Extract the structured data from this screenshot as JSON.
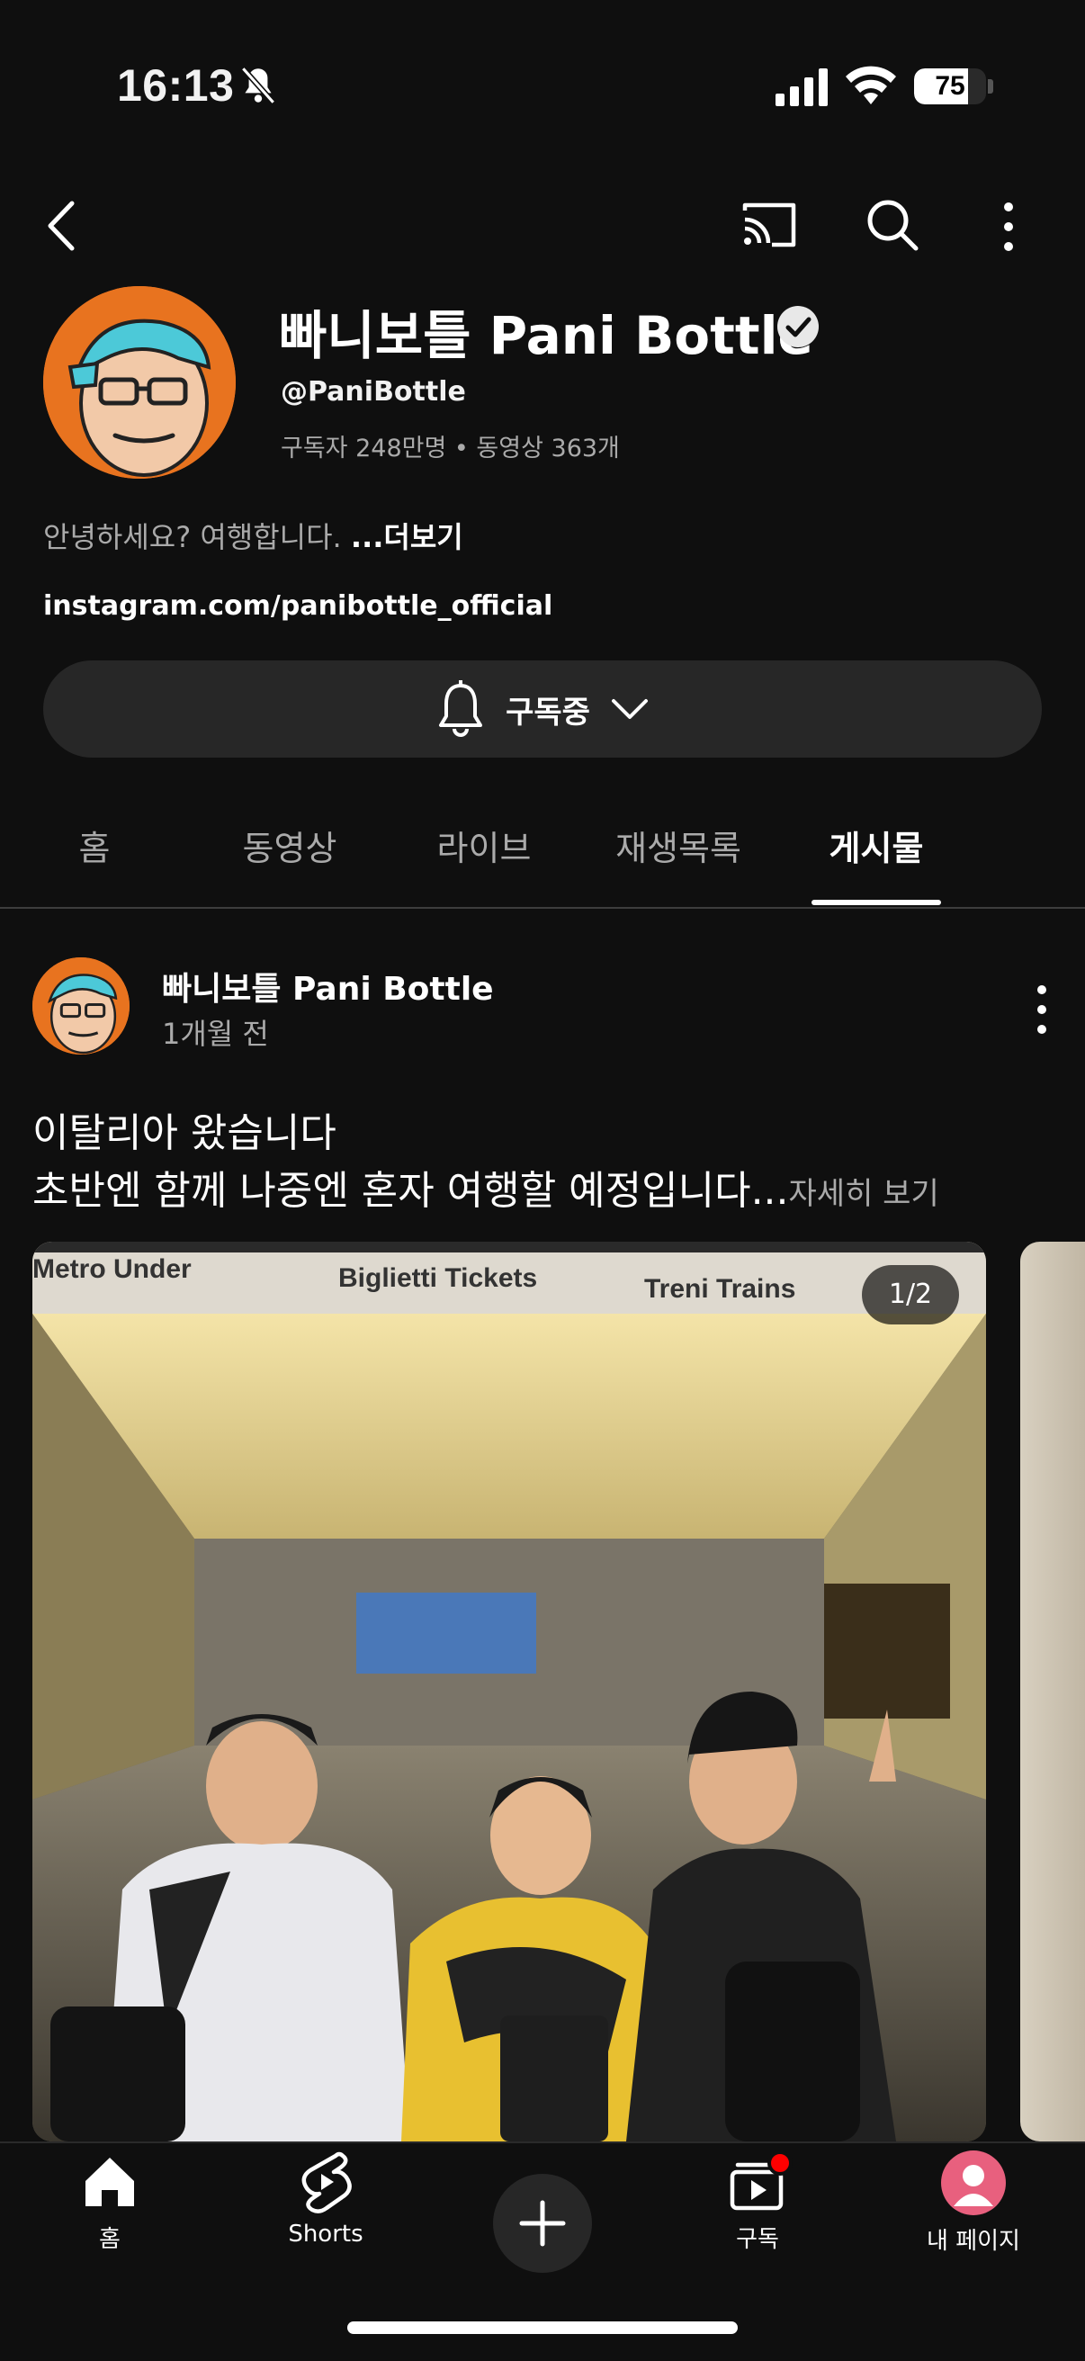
{
  "status_bar": {
    "time": "16:13",
    "battery": "75"
  },
  "channel": {
    "name": "빠니보틀 Pani Bottle",
    "handle": "@PaniBottle",
    "stats": "구독자 248만명 • 동영상 363개",
    "description": "안녕하세요? 여행합니다.",
    "description_more": "...더보기",
    "link": "instagram.com/panibottle_official",
    "subscribe_label": "구독중"
  },
  "tabs": [
    {
      "label": "홈"
    },
    {
      "label": "동영상"
    },
    {
      "label": "라이브"
    },
    {
      "label": "재생목록"
    },
    {
      "label": "게시물"
    }
  ],
  "post": {
    "author": "빠니보틀 Pani Bottle",
    "time": "1개월 전",
    "text_line1": "이탈리아 왔습니다",
    "text_line2": "초반엔 함께 나중엔 혼자 여행할 예정입니다...",
    "more_label": "자세히 보기",
    "page_indicator": "1/2",
    "photo_signs": {
      "sign1": "Metro Under",
      "sign2": "Biglietti Tickets",
      "sign3": "Treni Trains"
    }
  },
  "bottom_nav": [
    {
      "label": "홈",
      "icon": "home-icon"
    },
    {
      "label": "Shorts",
      "icon": "shorts-icon"
    },
    {
      "label": "",
      "icon": "add-icon"
    },
    {
      "label": "구독",
      "icon": "subscriptions-icon"
    },
    {
      "label": "내 페이지",
      "icon": "profile-icon"
    }
  ],
  "colors": {
    "background": "#0f0f0f",
    "avatar_orange": "#e8731f",
    "notification_red": "#ff0000",
    "profile_pink": "#e8607e"
  }
}
